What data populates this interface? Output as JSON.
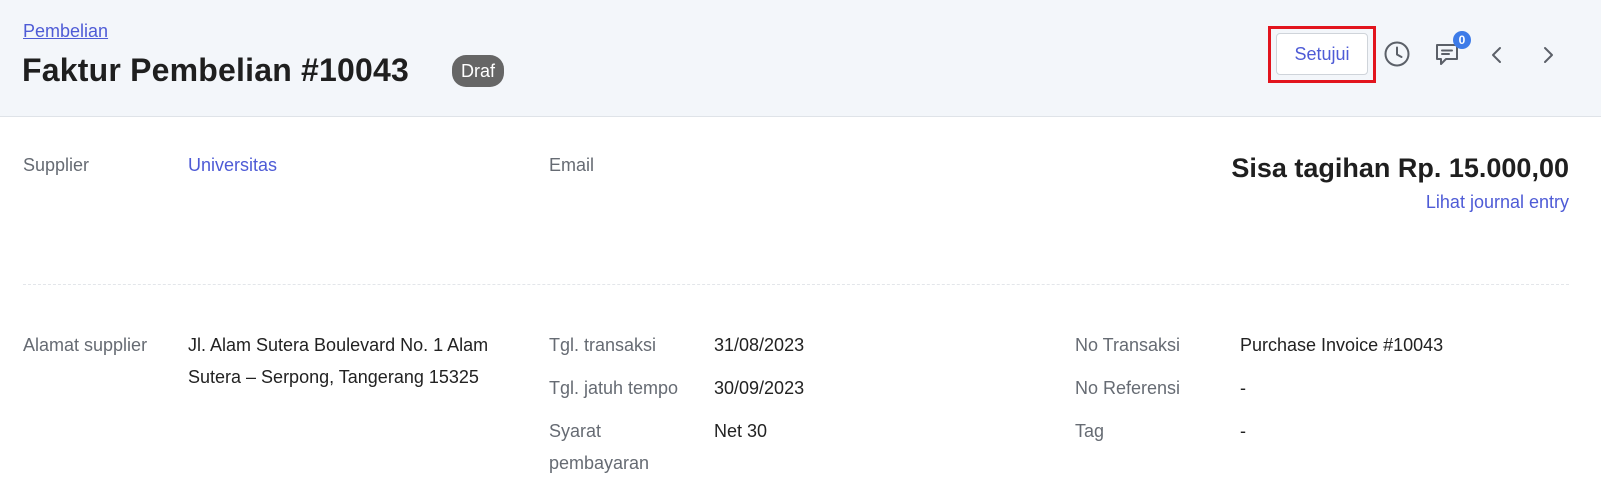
{
  "header": {
    "breadcrumb": "Pembelian",
    "title": "Faktur Pembelian #10043",
    "status": "Draf",
    "approve_label": "Setujui",
    "comment_count": "0"
  },
  "supplier": {
    "label": "Supplier",
    "name": "Universitas",
    "email_label": "Email",
    "email_value": ""
  },
  "balance": {
    "text": "Sisa tagihan Rp. 15.000,00",
    "journal_link": "Lihat journal entry"
  },
  "details": {
    "address_label": "Alamat supplier",
    "address_value": "Jl. Alam Sutera Boulevard No. 1 Alam Sutera – Serpong, Tangerang 15325",
    "transaction_date_label": "Tgl. transaksi",
    "transaction_date_value": "31/08/2023",
    "due_date_label": "Tgl. jatuh tempo",
    "due_date_value": "30/09/2023",
    "terms_label": "Syarat pembayaran",
    "terms_value": "Net 30",
    "transaction_no_label": "No Transaksi",
    "transaction_no_value": "Purchase Invoice #10043",
    "reference_label": "No Referensi",
    "reference_value": "-",
    "tag_label": "Tag",
    "tag_value": "-"
  },
  "icons": {
    "history": "clock-icon",
    "comments": "comment-icon",
    "previous": "chevron-left-icon",
    "next": "chevron-right-icon"
  },
  "colors": {
    "accent": "#4e5bd6",
    "highlight": "#e2141d",
    "badge": "#666666",
    "count_badge": "#3d7be8"
  }
}
